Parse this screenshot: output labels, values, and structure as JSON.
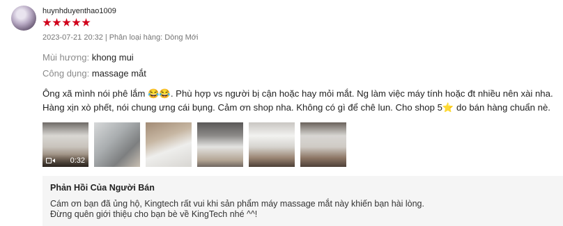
{
  "review": {
    "username": "huynhduyenthao1009",
    "rating": 5,
    "date": "2023-07-21 20:32",
    "meta_separator": "|",
    "variation": "Phân loại hàng: Dòng Mới",
    "attributes": [
      {
        "label": "Mùi hương:",
        "value": "khong mui"
      },
      {
        "label": "Công dụng:",
        "value": "massage mắt"
      }
    ],
    "comment": "Ông xã mình nói phê lắm 😂😂. Phù hợp vs người bị cận hoặc hay mỏi mắt. Ng làm việc máy tính hoặc đt nhiều nên xài nha. Hàng xịn xò phết, nói chung ưng cái bụng. Cảm ơn shop nha. Không có gì để chê lun. Cho shop 5⭐ do bán hàng chuẩn nè.",
    "video": {
      "duration": "0:32",
      "icon": "video-camera-icon"
    },
    "media_count": 6
  },
  "seller_reply": {
    "title": "Phản Hồi Của Người Bán",
    "line1": "Cám ơn bạn đã ủng hộ, Kingtech rất vui khi sản phẩm máy massage mắt này khiến bạn hài lòng.",
    "line2": "Đừng quên giới thiệu cho bạn bè về KingTech nhé ^^!"
  },
  "colors": {
    "star": "#d0011b",
    "reply_bg": "#f5f5f5",
    "muted_text": "#757575"
  }
}
